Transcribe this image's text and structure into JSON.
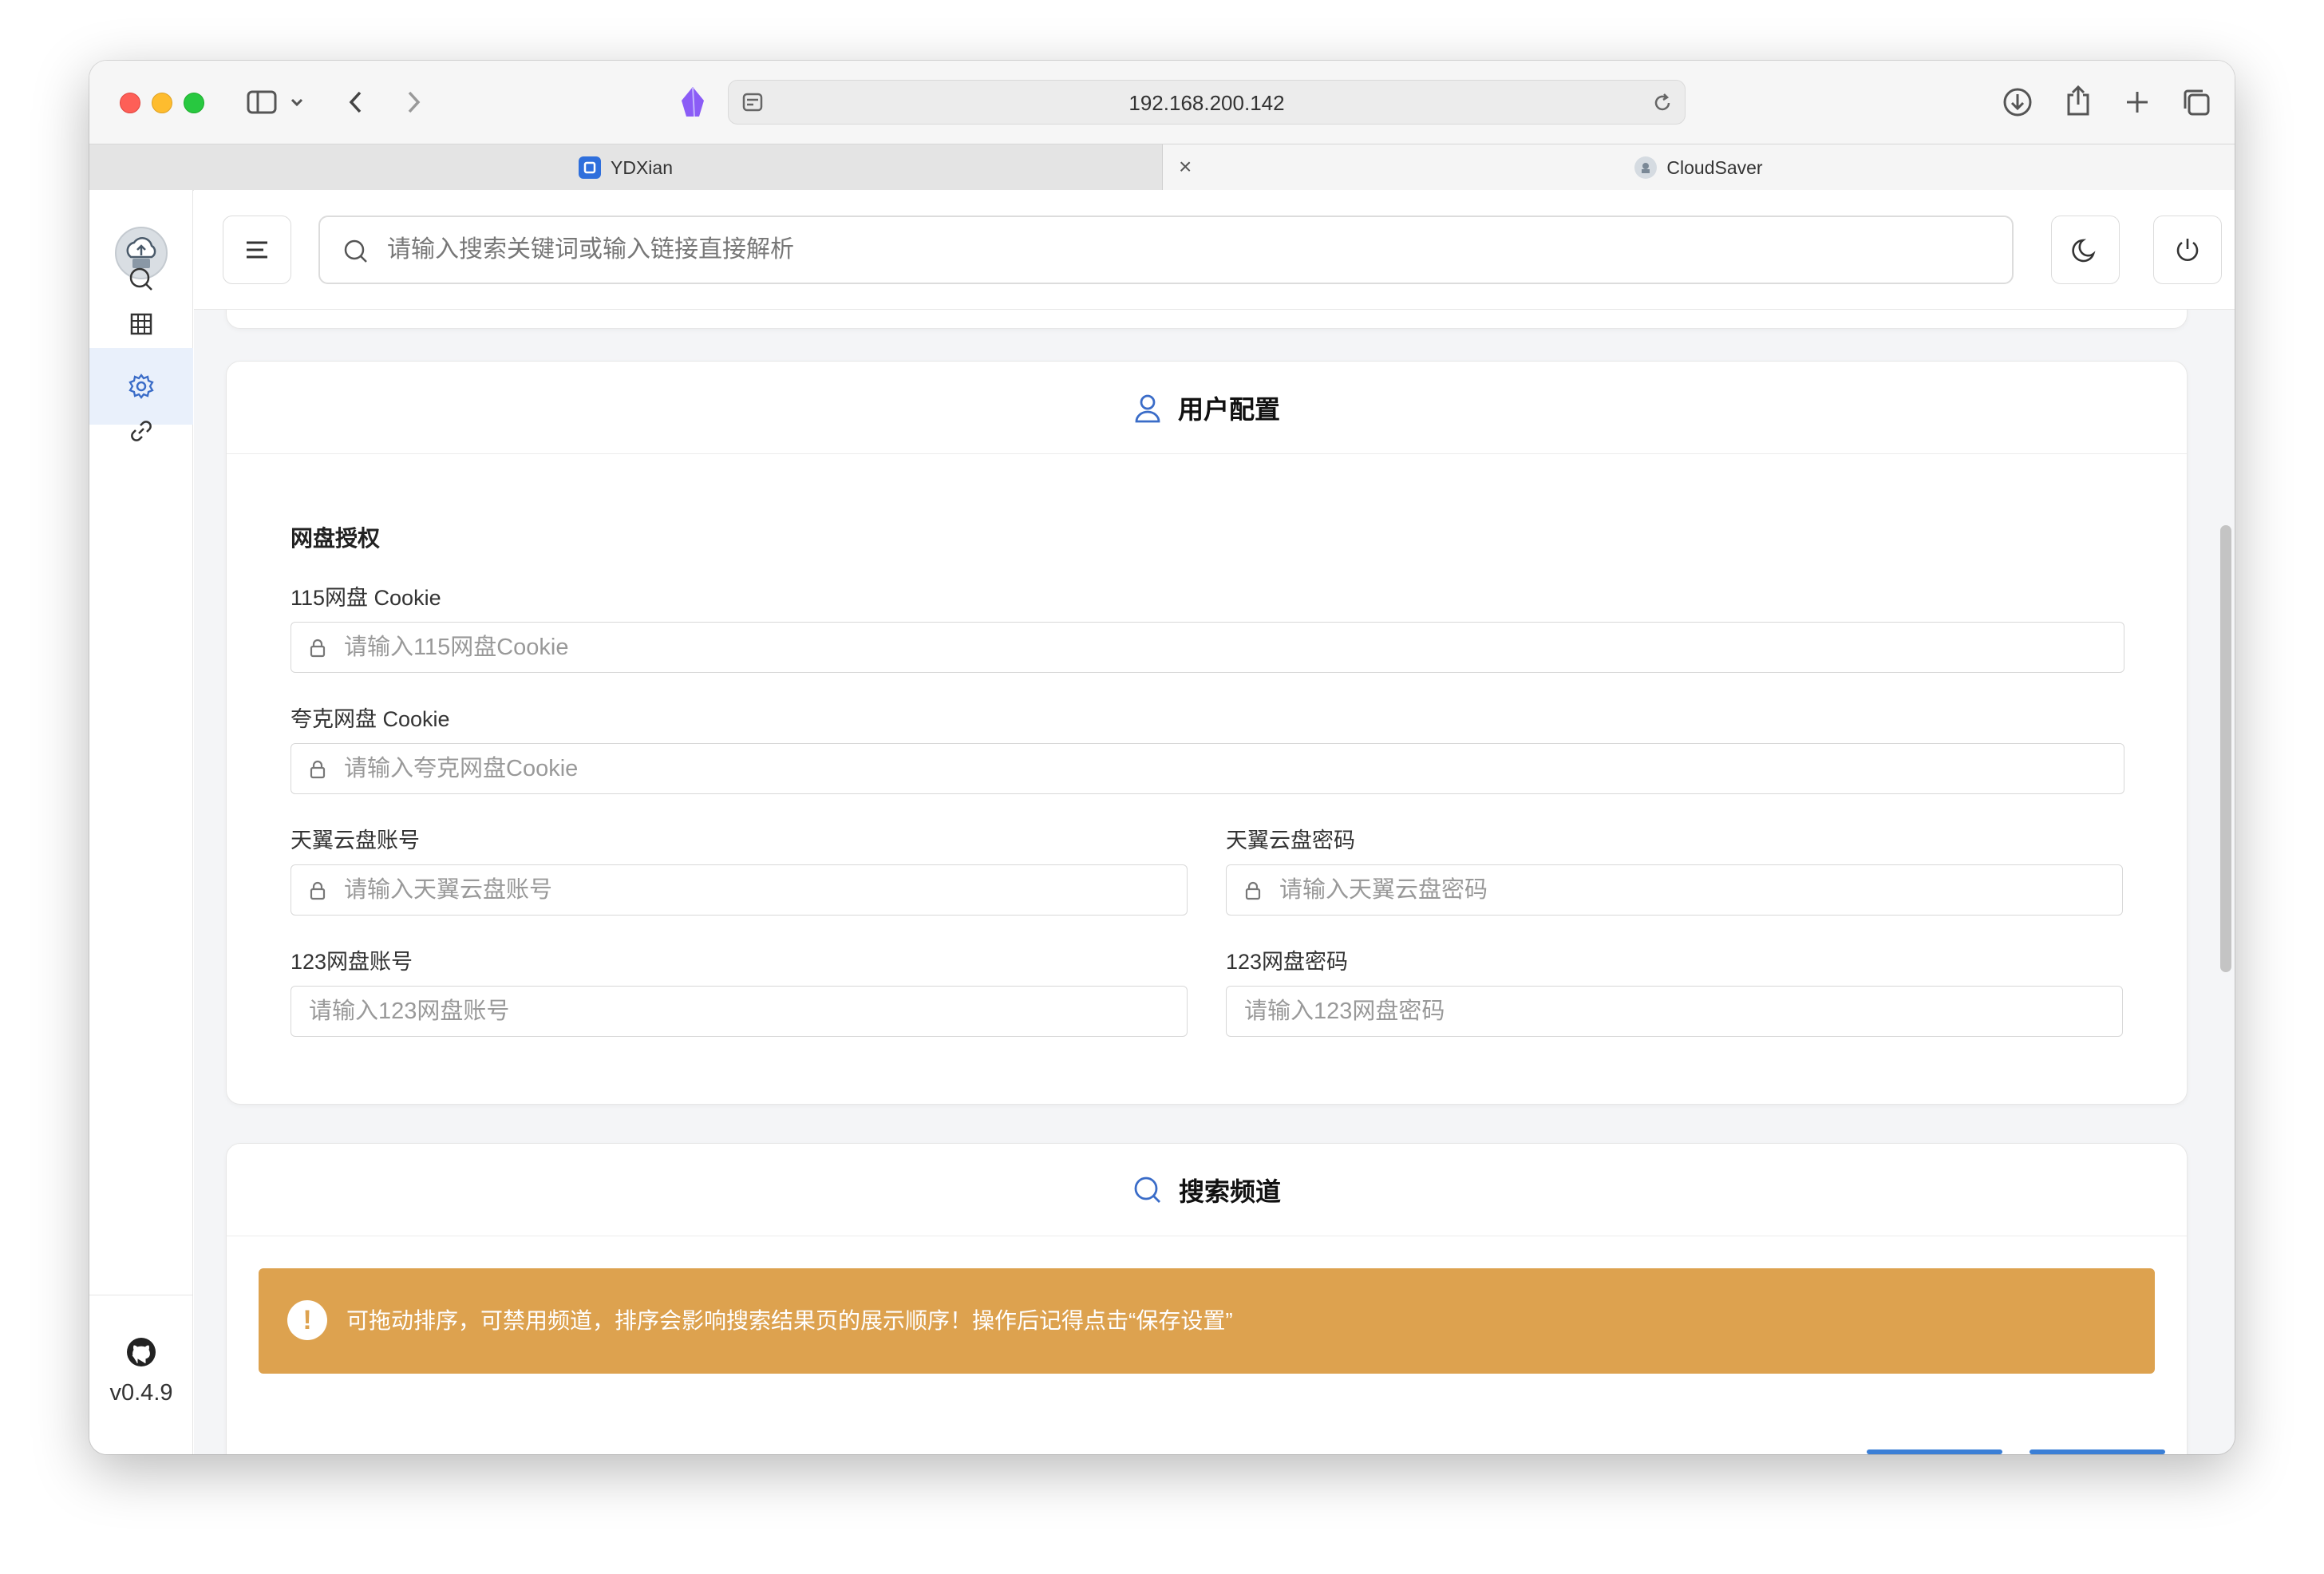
{
  "browser": {
    "address": "192.168.200.142",
    "tabs": [
      {
        "label": "YDXian",
        "active": false
      },
      {
        "label": "CloudSaver",
        "active": true
      }
    ]
  },
  "sidebar": {
    "version": "v0.4.9",
    "items": [
      {
        "icon": "search-icon"
      },
      {
        "icon": "grid-icon"
      },
      {
        "icon": "gear-icon",
        "active": true
      },
      {
        "icon": "link-icon"
      }
    ]
  },
  "topbar": {
    "search_placeholder": "请输入搜索关键词或输入链接直接解析"
  },
  "user_config": {
    "title": "用户配置",
    "section_title": "网盘授权",
    "fields": {
      "cookie115": {
        "label": "115网盘 Cookie",
        "placeholder": "请输入115网盘Cookie"
      },
      "quark": {
        "label": "夸克网盘 Cookie",
        "placeholder": "请输入夸克网盘Cookie"
      },
      "tianyi_account": {
        "label": "天翼云盘账号",
        "placeholder": "请输入天翼云盘账号"
      },
      "tianyi_password": {
        "label": "天翼云盘密码",
        "placeholder": "请输入天翼云盘密码"
      },
      "p123_account": {
        "label": "123网盘账号",
        "placeholder": "请输入123网盘账号"
      },
      "p123_password": {
        "label": "123网盘密码",
        "placeholder": "请输入123网盘密码"
      }
    }
  },
  "search_channels": {
    "title": "搜索频道",
    "alert": "可拖动排序，可禁用频道，排序会影响搜索结果页的展示顺序！操作后记得点击“保存设置”"
  },
  "colors": {
    "accent": "#3a6cc8",
    "warning": "#dda24f"
  }
}
